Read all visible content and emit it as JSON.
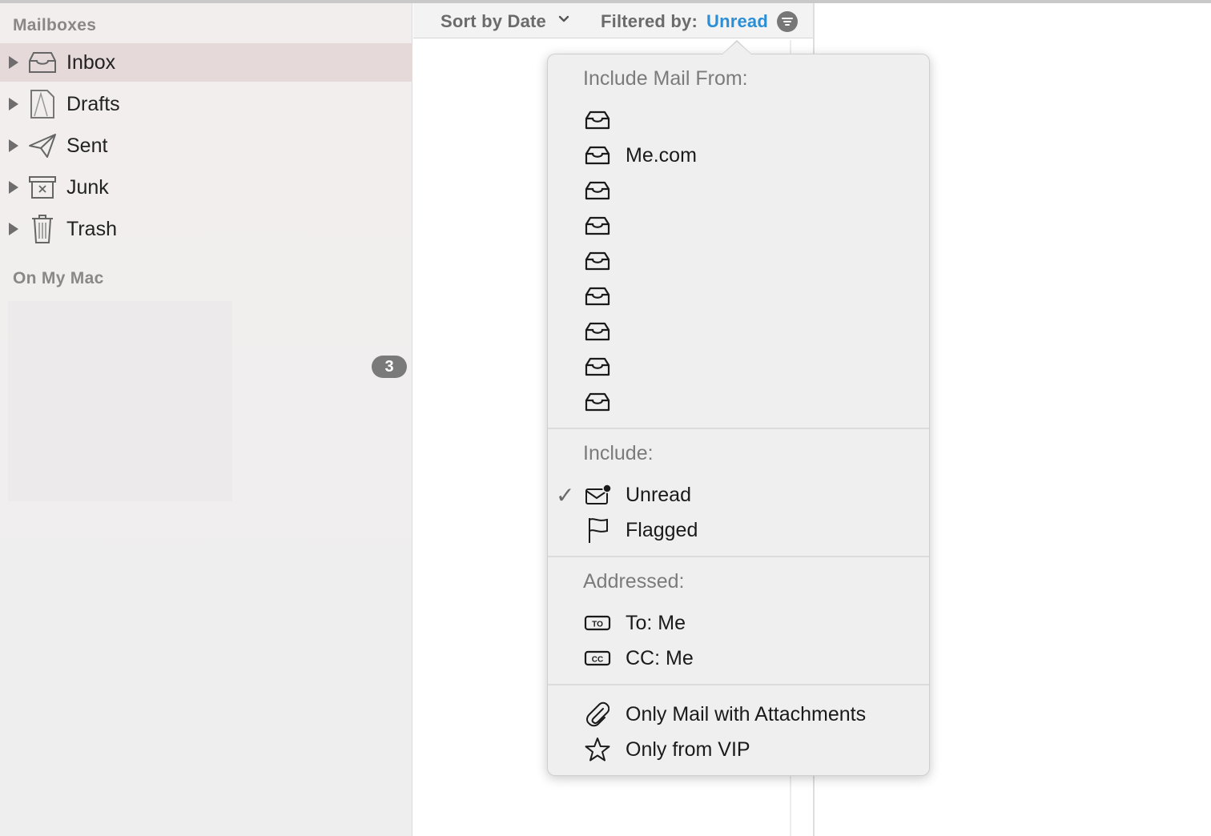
{
  "sidebar": {
    "mailboxes_header": "Mailboxes",
    "on_my_mac_header": "On My Mac",
    "items": [
      {
        "label": "Inbox",
        "icon": "inbox-icon",
        "selected": true
      },
      {
        "label": "Drafts",
        "icon": "drafts-icon",
        "selected": false
      },
      {
        "label": "Sent",
        "icon": "sent-icon",
        "selected": false
      },
      {
        "label": "Junk",
        "icon": "junk-icon",
        "selected": false
      },
      {
        "label": "Trash",
        "icon": "trash-icon",
        "selected": false
      }
    ],
    "badge_count": "3"
  },
  "toolbar": {
    "sort_label": "Sort by Date",
    "filter_label": "Filtered by:",
    "filter_value": "Unread",
    "accent_color": "#2a8fd6"
  },
  "filter_popover": {
    "include_mail_from_header": "Include Mail From:",
    "accounts": [
      {
        "label": ""
      },
      {
        "label": "Me.com"
      },
      {
        "label": ""
      },
      {
        "label": ""
      },
      {
        "label": ""
      },
      {
        "label": ""
      },
      {
        "label": ""
      },
      {
        "label": ""
      },
      {
        "label": ""
      }
    ],
    "include_header": "Include:",
    "include_options": [
      {
        "label": "Unread",
        "checked": true,
        "icon": "unread-envelope-icon"
      },
      {
        "label": "Flagged",
        "checked": false,
        "icon": "flag-icon"
      }
    ],
    "addressed_header": "Addressed:",
    "addressed_options": [
      {
        "label": "To: Me",
        "icon": "to-icon",
        "icon_text": "TO"
      },
      {
        "label": "CC: Me",
        "icon": "cc-icon",
        "icon_text": "CC"
      }
    ],
    "other_options": [
      {
        "label": "Only Mail with Attachments",
        "icon": "paperclip-icon"
      },
      {
        "label": "Only from VIP",
        "icon": "star-icon"
      }
    ],
    "checkmark": "✓"
  }
}
